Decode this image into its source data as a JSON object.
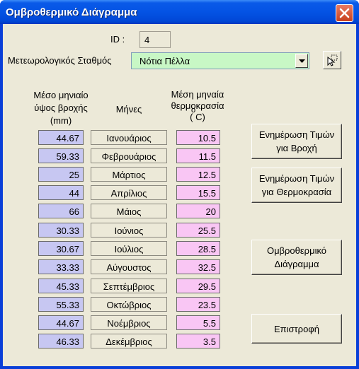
{
  "window": {
    "title": "Ομβροθερμικό Διάγραμμα",
    "close_icon": "close-icon"
  },
  "id_field": {
    "label": "ID :",
    "value": "4"
  },
  "station": {
    "label": "Μετεωρολογικός Σταθμός",
    "value": "Νότια Πέλλα",
    "bg_color": "#c8f7c5"
  },
  "headers": {
    "rain": [
      "Μέσο μηνιαίο",
      "ύψος βροχής",
      "(mm)"
    ],
    "months": "Μήνες",
    "temp": [
      "Μέση μηναία",
      "θερμοκρασία",
      "(  C)"
    ]
  },
  "months": [
    {
      "name": "Ιανουάριος",
      "rain": "44.67",
      "temp": "10.5"
    },
    {
      "name": "Φεβρουάριος",
      "rain": "59.33",
      "temp": "11.5"
    },
    {
      "name": "Μάρτιος",
      "rain": "25",
      "temp": "12.5"
    },
    {
      "name": "Απρίλιος",
      "rain": "44",
      "temp": "15.5"
    },
    {
      "name": "Μάιος",
      "rain": "66",
      "temp": "20"
    },
    {
      "name": "Ιούνιος",
      "rain": "30.33",
      "temp": "25.5"
    },
    {
      "name": "Ιούλιος",
      "rain": "30.67",
      "temp": "28.5"
    },
    {
      "name": "Αύγουστος",
      "rain": "33.33",
      "temp": "32.5"
    },
    {
      "name": "Σεπτέμβριος",
      "rain": "45.33",
      "temp": "29.5"
    },
    {
      "name": "Οκτώβριος",
      "rain": "55.33",
      "temp": "23.5"
    },
    {
      "name": "Νοέμβριος",
      "rain": "44.67",
      "temp": "5.5"
    },
    {
      "name": "Δεκέμβριος",
      "rain": "46.33",
      "temp": "3.5"
    }
  ],
  "buttons": {
    "update_rain": [
      "Ενημέρωση Τιμών",
      "για Βροχή"
    ],
    "update_temp": [
      "Ενημέρωση Τιμών",
      "για Θερμοκρασία"
    ],
    "diagram": [
      "Ομβροθερμικό",
      "Διάγραμμα"
    ],
    "back": "Επιστροφή"
  },
  "colors": {
    "rain_cell": "#c7c7f2",
    "temp_cell": "#f9c6f4",
    "titlebar": "#0453e4"
  }
}
